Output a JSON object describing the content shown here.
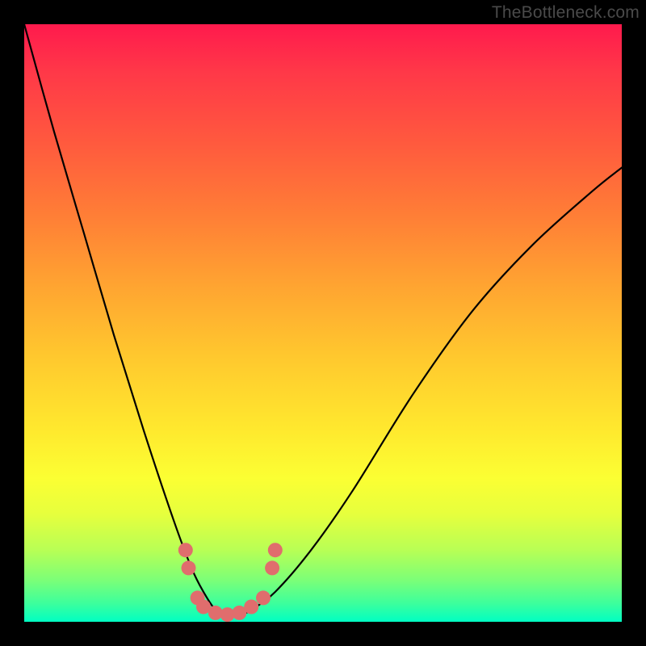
{
  "watermark": "TheBottleneck.com",
  "chart_data": {
    "type": "line",
    "title": "",
    "xlabel": "",
    "ylabel": "",
    "xlim": [
      0,
      100
    ],
    "ylim": [
      0,
      100
    ],
    "grid": false,
    "series": [
      {
        "name": "bottleneck-curve",
        "x": [
          0,
          5,
          10,
          15,
          20,
          25,
          28,
          30,
          32,
          34,
          35,
          36,
          38,
          42,
          48,
          55,
          65,
          75,
          85,
          95,
          100
        ],
        "y": [
          100,
          82,
          65,
          48,
          32,
          17,
          9,
          5,
          2,
          1,
          1,
          1,
          2,
          5,
          12,
          22,
          38,
          52,
          63,
          72,
          76
        ]
      }
    ],
    "markers": {
      "name": "highlight-dots",
      "color": "#e06d6d",
      "points": [
        {
          "x": 27,
          "y": 12
        },
        {
          "x": 27.5,
          "y": 9
        },
        {
          "x": 29,
          "y": 4
        },
        {
          "x": 30,
          "y": 2.5
        },
        {
          "x": 32,
          "y": 1.5
        },
        {
          "x": 34,
          "y": 1.2
        },
        {
          "x": 36,
          "y": 1.5
        },
        {
          "x": 38,
          "y": 2.5
        },
        {
          "x": 40,
          "y": 4
        },
        {
          "x": 41.5,
          "y": 9
        },
        {
          "x": 42,
          "y": 12
        }
      ]
    }
  }
}
